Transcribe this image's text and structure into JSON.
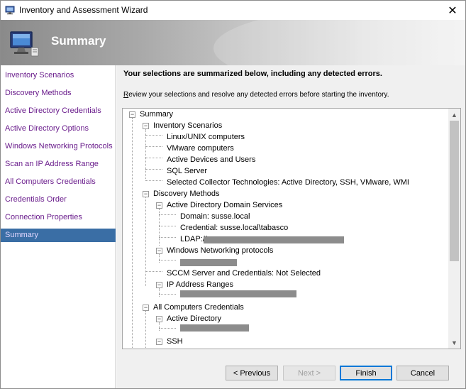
{
  "window": {
    "title": "Inventory and Assessment Wizard",
    "close_glyph": "✕"
  },
  "banner": {
    "heading": "Summary",
    "icon": "computer-monitor-icon"
  },
  "sidebar": {
    "items": [
      {
        "label": "Inventory Scenarios",
        "active": false
      },
      {
        "label": "Discovery Methods",
        "active": false
      },
      {
        "label": "Active Directory Credentials",
        "active": false
      },
      {
        "label": "Active Directory Options",
        "active": false
      },
      {
        "label": "Windows Networking Protocols",
        "active": false
      },
      {
        "label": "Scan an IP Address Range",
        "active": false
      },
      {
        "label": "All Computers Credentials",
        "active": false
      },
      {
        "label": "Credentials Order",
        "active": false
      },
      {
        "label": "Connection Properties",
        "active": false
      },
      {
        "label": "Summary",
        "active": true
      }
    ]
  },
  "main": {
    "lead": "Your selections are summarized below, including any detected errors.",
    "instr_first_letter": "R",
    "instr_rest": "eview your selections and resolve any detected errors before starting the inventory."
  },
  "tree": {
    "root": "Summary",
    "inventory_scenarios": {
      "label": "Inventory Scenarios",
      "items": [
        "Linux/UNIX computers",
        "VMware computers",
        "Active Devices and Users",
        "SQL Server",
        "Selected Collector Technologies: Active Directory, SSH, VMware, WMI"
      ]
    },
    "discovery_methods": {
      "label": "Discovery Methods",
      "ad_domain_services": "Active Directory Domain Services",
      "domain": "Domain: susse.local",
      "credential": "Credential: susse.local\\tabasco",
      "ldap_prefix": "LDAP://",
      "windows_networking": "Windows Networking protocols",
      "sccm": "SCCM Server and Credentials: Not Selected",
      "ip_ranges": "IP Address Ranges"
    },
    "all_computers_credentials": {
      "label": "All Computers Credentials",
      "active_directory": "Active Directory",
      "ssh": "SSH"
    },
    "expand_glyph": "−"
  },
  "buttons": {
    "previous": "< Previous",
    "next": "Next >",
    "finish": "Finish",
    "cancel": "Cancel"
  },
  "colors": {
    "nav_link": "#6a1d8c",
    "nav_active_bg": "#3a6ea5",
    "default_button_border": "#0078d7"
  }
}
